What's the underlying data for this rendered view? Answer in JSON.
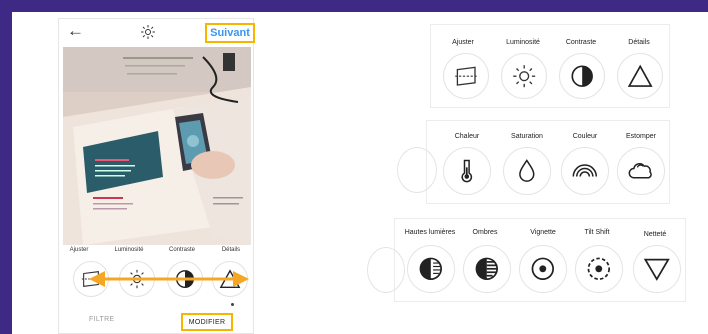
{
  "phone": {
    "next_label": "Suivant",
    "tools": [
      {
        "label": "Ajuster",
        "icon": "adjust-icon"
      },
      {
        "label": "Luminosité",
        "icon": "brightness-icon"
      },
      {
        "label": "Contraste",
        "icon": "contrast-icon"
      },
      {
        "label": "Détails",
        "icon": "details-icon"
      }
    ],
    "tabs": {
      "filter": "FILTRE",
      "modify": "MODIFIER"
    }
  },
  "strip1": {
    "tools": [
      {
        "label": "Ajuster",
        "icon": "adjust-icon"
      },
      {
        "label": "Luminosité",
        "icon": "brightness-icon"
      },
      {
        "label": "Contraste",
        "icon": "contrast-icon"
      },
      {
        "label": "Détails",
        "icon": "details-icon"
      }
    ]
  },
  "strip2": {
    "tools": [
      {
        "label": "Chaleur",
        "icon": "thermometer-icon"
      },
      {
        "label": "Saturation",
        "icon": "drop-icon"
      },
      {
        "label": "Couleur",
        "icon": "rainbow-icon"
      },
      {
        "label": "Estomper",
        "icon": "fade-cloud-icon"
      }
    ]
  },
  "strip3": {
    "tools": [
      {
        "label": "Hautes lumières",
        "icon": "highlights-icon"
      },
      {
        "label": "Ombres",
        "icon": "shadows-icon"
      },
      {
        "label": "Vignette",
        "icon": "vignette-icon"
      },
      {
        "label": "Tilt Shift",
        "icon": "tilt-shift-icon"
      },
      {
        "label": "Netteté",
        "icon": "sharpen-icon"
      }
    ]
  },
  "colors": {
    "accent_yellow": "#f7b500",
    "instagram_blue": "#3897f0",
    "frame_purple": "#3e2a84",
    "arrow_orange": "#f5a623"
  }
}
